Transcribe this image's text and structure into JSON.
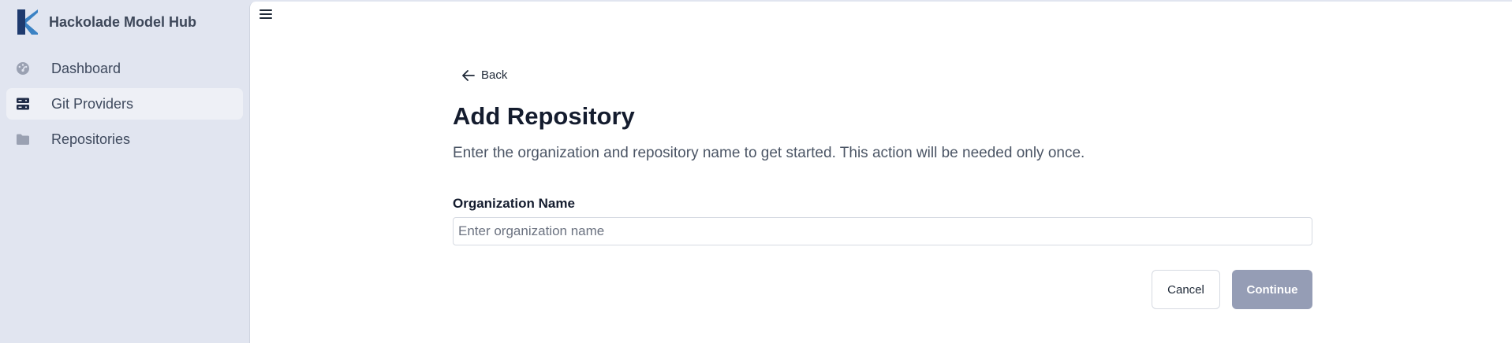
{
  "app": {
    "name": "Hackolade Model Hub"
  },
  "sidebar": {
    "items": [
      {
        "label": "Dashboard",
        "icon": "dashboard-icon",
        "active": false
      },
      {
        "label": "Git Providers",
        "icon": "server-icon",
        "active": true
      },
      {
        "label": "Repositories",
        "icon": "folder-icon",
        "active": false
      }
    ]
  },
  "header": {
    "menu_icon": "hamburger-menu-icon"
  },
  "page": {
    "back_label": "Back",
    "title": "Add Repository",
    "subtitle": "Enter the organization and repository name to get started. This action will be needed only once.",
    "org_field": {
      "label": "Organization Name",
      "value": "",
      "placeholder": "Enter organization name"
    },
    "buttons": {
      "cancel": "Cancel",
      "continue": "Continue"
    }
  },
  "colors": {
    "sidebar_bg": "#e1e5f0",
    "brand_dark": "#1e3a6e",
    "brand_light": "#3b82c4",
    "continue_disabled": "#959db5"
  }
}
